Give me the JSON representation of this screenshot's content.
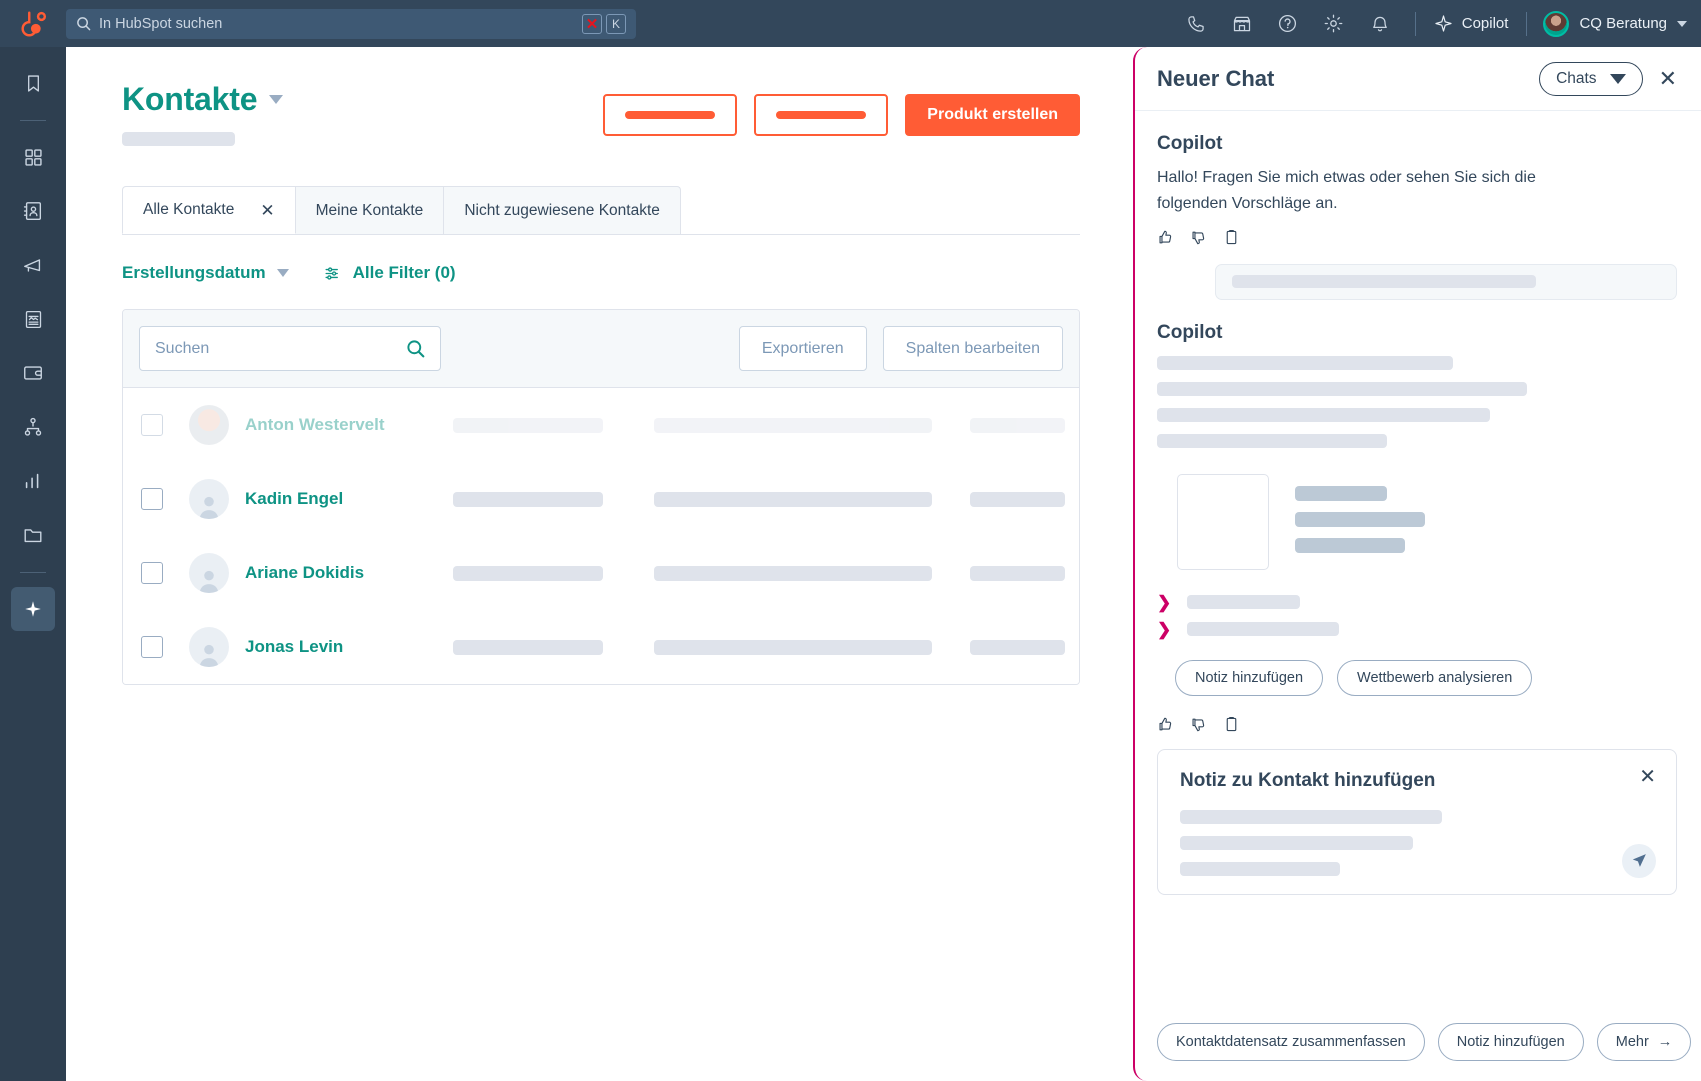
{
  "topnav": {
    "logo": "hubspot-sprocket-logo",
    "search": {
      "placeholder": "In HubSpot suchen",
      "shortcut_badge": "✕",
      "shortcut_key": "K"
    },
    "icons": [
      "phone-icon",
      "marketplace-icon",
      "help-icon",
      "settings-gear-icon",
      "notifications-bell-icon"
    ],
    "copilot_label": "Copilot",
    "account_name": "CQ Beratung"
  },
  "rail": {
    "items": [
      {
        "name": "bookmark-icon"
      },
      {
        "name": "apps-grid-icon"
      },
      {
        "name": "contacts-icon"
      },
      {
        "name": "marketing-megaphone-icon"
      },
      {
        "name": "content-icon"
      },
      {
        "name": "commerce-wallet-icon"
      },
      {
        "name": "automation-icon"
      },
      {
        "name": "reporting-bars-icon"
      },
      {
        "name": "library-folder-icon"
      },
      {
        "name": "copilot-sparkle-icon"
      }
    ]
  },
  "page": {
    "title": "Kontakte",
    "actions": {
      "ghost_one": "",
      "ghost_two": "",
      "primary": "Produkt erstellen"
    },
    "tabs": [
      {
        "label": "Alle Kontakte",
        "active": true,
        "closable": true,
        "close": "✕"
      },
      {
        "label": "Meine Kontakte",
        "active": false
      },
      {
        "label": "Nicht zugewiesene Kontakte",
        "active": false
      }
    ],
    "filters": {
      "date_filter": "Erstellungsdatum",
      "all_filters": "Alle Filter (0)"
    },
    "toolbar": {
      "search_placeholder": "Suchen",
      "export_label": "Exportieren",
      "columns_label": "Spalten bearbeiten"
    },
    "rows": [
      {
        "name": "Anton Westervelt",
        "faded": true,
        "avatar": "photo"
      },
      {
        "name": "Kadin Engel",
        "faded": false,
        "avatar": "placeholder"
      },
      {
        "name": "Ariane Dokidis",
        "faded": false,
        "avatar": "placeholder"
      },
      {
        "name": "Jonas Levin",
        "faded": false,
        "avatar": "placeholder"
      }
    ]
  },
  "panel": {
    "title": "Neuer Chat",
    "chats_label": "Chats",
    "close": "✕",
    "message_one": {
      "author": "Copilot",
      "text": "Hallo! Fragen Sie mich etwas oder sehen Sie sich die folgenden Vorschläge an."
    },
    "message_two": {
      "author": "Copilot"
    },
    "chips": [
      "Notiz hinzufügen",
      "Wettbewerb analysieren"
    ],
    "composer": {
      "title": "Notiz zu Kontakt hinzufügen",
      "close": "✕"
    },
    "footer_chips": [
      "Kontaktdatensatz zusammenfassen",
      "Notiz hinzufügen",
      "Mehr"
    ],
    "footer_more_arrow": "→"
  },
  "colors": {
    "nav_bg": "#33475b",
    "rail_bg": "#2e3f50",
    "accent_teal": "#0e9384",
    "accent_orange": "#ff5c35",
    "panel_border_magenta": "#cc0066",
    "skeleton": "#dfe3eb"
  }
}
